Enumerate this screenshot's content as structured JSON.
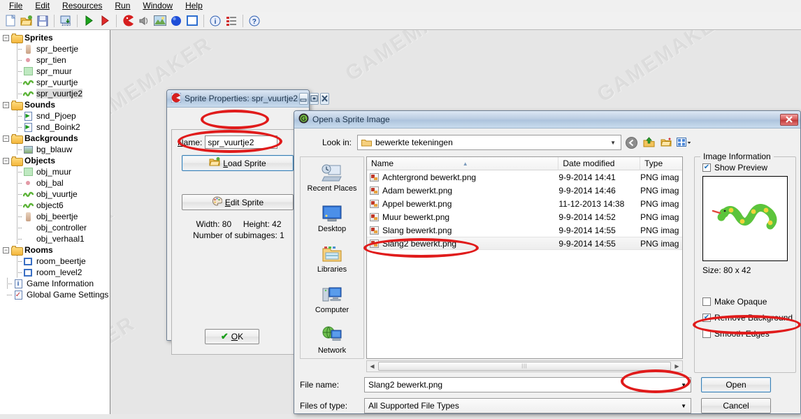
{
  "app": {
    "watermark_text": "GAMEMAKER"
  },
  "menubar": {
    "items": [
      {
        "label": "File",
        "accel": "F"
      },
      {
        "label": "Edit",
        "accel": "E"
      },
      {
        "label": "Resources",
        "accel": "R"
      },
      {
        "label": "Run",
        "accel": "u"
      },
      {
        "label": "Window",
        "accel": "W"
      },
      {
        "label": "Help",
        "accel": "H"
      }
    ]
  },
  "toolbar": {
    "buttons": [
      {
        "name": "new-file-icon",
        "title": "New"
      },
      {
        "name": "open-file-icon",
        "title": "Open"
      },
      {
        "name": "save-file-icon",
        "title": "Save"
      },
      {
        "name": "compile-icon",
        "title": "Create Executable"
      },
      {
        "name": "run-icon",
        "title": "Run"
      },
      {
        "name": "debug-run-icon",
        "title": "Run in Debug Mode"
      },
      {
        "name": "create-sprite-icon",
        "title": "Create Sprite"
      },
      {
        "name": "create-sound-icon",
        "title": "Create Sound"
      },
      {
        "name": "create-background-icon",
        "title": "Create Background"
      },
      {
        "name": "create-object-icon",
        "title": "Create Object"
      },
      {
        "name": "create-room-icon",
        "title": "Create Room"
      },
      {
        "name": "game-information-icon",
        "title": "Game Information"
      },
      {
        "name": "global-game-settings-icon",
        "title": "Global Game Settings"
      },
      {
        "name": "help-icon",
        "title": "Help"
      }
    ]
  },
  "tree": {
    "groups": [
      {
        "label": "Sprites",
        "icon": "folder-icon",
        "children": [
          {
            "label": "spr_beertje",
            "icon": "sprite-bear-icon"
          },
          {
            "label": "spr_tien",
            "icon": "sprite-ball-icon"
          },
          {
            "label": "spr_muur",
            "icon": "sprite-wall-icon"
          },
          {
            "label": "spr_vuurtje",
            "icon": "sprite-snake-icon"
          },
          {
            "label": "spr_vuurtje2",
            "icon": "sprite-snake-icon",
            "selected": true
          }
        ]
      },
      {
        "label": "Sounds",
        "icon": "folder-icon",
        "children": [
          {
            "label": "snd_Pjoep",
            "icon": "sound-icon"
          },
          {
            "label": "snd_Boink2",
            "icon": "sound-icon"
          }
        ]
      },
      {
        "label": "Backgrounds",
        "icon": "folder-icon",
        "children": [
          {
            "label": "bg_blauw",
            "icon": "background-icon"
          }
        ]
      },
      {
        "label": "Objects",
        "icon": "folder-icon",
        "children": [
          {
            "label": "obj_muur",
            "icon": "sprite-wall-icon"
          },
          {
            "label": "obj_bal",
            "icon": "sprite-ball-icon"
          },
          {
            "label": "obj_vuurtje",
            "icon": "sprite-snake-icon"
          },
          {
            "label": "object6",
            "icon": "sprite-snake-icon"
          },
          {
            "label": "obj_beertje",
            "icon": "sprite-bear-icon"
          },
          {
            "label": "obj_controller",
            "icon": "none-icon"
          },
          {
            "label": "obj_verhaal1",
            "icon": "none-icon"
          }
        ]
      },
      {
        "label": "Rooms",
        "icon": "folder-icon",
        "children": [
          {
            "label": "room_beertje",
            "icon": "room-icon"
          },
          {
            "label": "room_level2",
            "icon": "room-icon"
          }
        ]
      }
    ],
    "leaf_items": [
      {
        "label": "Game Information",
        "icon": "game-information-icon"
      },
      {
        "label": "Global Game Settings",
        "icon": "global-game-settings-icon"
      }
    ]
  },
  "sprite_properties": {
    "title": "Sprite Properties: spr_vuurtje2",
    "icon": "sprite-window-icon",
    "name_label": "Name:",
    "name_label_accel": "N",
    "name_value": "spr_vuurtje2",
    "load_sprite_label": "Load Sprite",
    "load_sprite_accel": "L",
    "edit_sprite_label": "Edit Sprite",
    "edit_sprite_accel": "E",
    "width_text": "Width: 80",
    "height_text": "Height: 42",
    "subimages_text": "Number of subimages: 1",
    "ok_label": "OK",
    "ok_accel": "O",
    "window_buttons": [
      "minimize",
      "maximize",
      "close"
    ]
  },
  "open_dialog": {
    "title": "Open a Sprite Image",
    "icon": "gamemaker-g-icon",
    "look_in_label": "Look in:",
    "look_in_value": "bewerkte tekeningen",
    "nav_buttons": [
      {
        "name": "back-icon"
      },
      {
        "name": "up-folder-icon"
      },
      {
        "name": "new-folder-icon"
      },
      {
        "name": "views-icon"
      }
    ],
    "places": [
      {
        "label": "Recent Places",
        "icon": "recent-places-icon"
      },
      {
        "label": "Desktop",
        "icon": "desktop-icon"
      },
      {
        "label": "Libraries",
        "icon": "libraries-icon"
      },
      {
        "label": "Computer",
        "icon": "computer-icon"
      },
      {
        "label": "Network",
        "icon": "network-icon"
      }
    ],
    "columns": [
      "Name",
      "Date modified",
      "Type"
    ],
    "files": [
      {
        "name": "Achtergrond bewerkt.png",
        "date": "9-9-2014 14:41",
        "type": "PNG imag"
      },
      {
        "name": "Adam bewerkt.png",
        "date": "9-9-2014 14:46",
        "type": "PNG imag"
      },
      {
        "name": "Appel bewerkt.png",
        "date": "11-12-2013 14:38",
        "type": "PNG imag"
      },
      {
        "name": "Muur bewerkt.png",
        "date": "9-9-2014 14:52",
        "type": "PNG imag"
      },
      {
        "name": "Slang bewerkt.png",
        "date": "9-9-2014 14:55",
        "type": "PNG imag"
      },
      {
        "name": "Slang2 bewerkt.png",
        "date": "9-9-2014 14:55",
        "type": "PNG imag",
        "selected": true
      }
    ],
    "file_name_label": "File name:",
    "file_name_value": "Slang2 bewerkt.png",
    "files_of_type_label": "Files of type:",
    "files_of_type_value": "All Supported File Types",
    "open_label": "Open",
    "cancel_label": "Cancel",
    "close_button": "close"
  },
  "image_information": {
    "legend": "Image Information",
    "show_preview_label": "Show Preview",
    "show_preview_checked": true,
    "size_text": "Size: 80 x 42",
    "make_opaque_label": "Make Opaque",
    "make_opaque_checked": false,
    "remove_background_label": "Remove Background",
    "remove_background_checked": true,
    "smooth_edges_label": "Smooth Edges",
    "smooth_edges_checked": false,
    "preview_image": "green-yellow-snake"
  },
  "annotations": {
    "color": "#e01b1b",
    "ellipses": [
      {
        "name": "highlight-name-field"
      },
      {
        "name": "highlight-load-sprite-button"
      },
      {
        "name": "highlight-selected-file"
      },
      {
        "name": "highlight-remove-background-checkbox"
      },
      {
        "name": "highlight-open-button"
      }
    ]
  }
}
